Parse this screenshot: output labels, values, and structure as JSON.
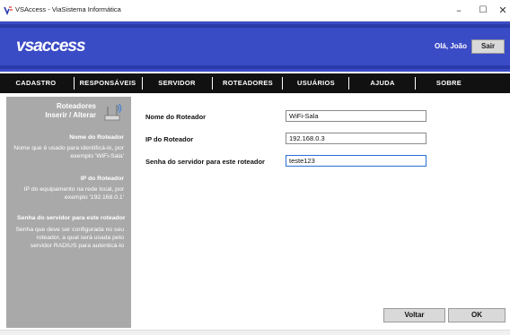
{
  "window": {
    "title": "VSAccess - ViaSistema Informática",
    "min_glyph": "–",
    "max_glyph": "☐",
    "close_glyph": "✕"
  },
  "header": {
    "logo": "vsaccess",
    "greeting": "Olá, João",
    "logout_label": "Sair"
  },
  "nav": [
    {
      "label": "CADASTRO"
    },
    {
      "label": "RESPONSÁVEIS"
    },
    {
      "label": "SERVIDOR"
    },
    {
      "label": "ROTEADORES"
    },
    {
      "label": "USUÁRIOS"
    },
    {
      "label": "AJUDA"
    },
    {
      "label": "SOBRE"
    }
  ],
  "sidebar": {
    "title_line1": "Roteadores",
    "title_line2": "Inserir / Alterar",
    "icon": "router-icon",
    "sections": [
      {
        "heading": "Nome do Roteador",
        "lines": [
          "Nome que é usado para identificá-lo, por",
          "exemplo 'WiFi-Sala'"
        ]
      },
      {
        "heading": "IP do Roteador",
        "lines": [
          "IP do equipamento na rede local, por",
          "exemplo '192.168.0.1'"
        ]
      },
      {
        "heading": "Senha do servidor para este roteador",
        "lines": [
          "Senha que deve ser configurada no seu",
          "roteador, a qual será usada pelo",
          "servidor RADIUS para autenticá-lo"
        ]
      }
    ]
  },
  "form": {
    "name_label": "Nome do Roteador",
    "name_value": "WiFi-Sala",
    "ip_label": "IP do Roteador",
    "ip_value": "192.168.0.3",
    "secret_label": "Senha do servidor para este roteador",
    "secret_value": "teste123"
  },
  "buttons": {
    "back_label": "Voltar",
    "ok_label": "OK"
  },
  "colors": {
    "header": "#3a4bc6",
    "nav": "#111111",
    "sidebar": "#a9a9a9"
  }
}
